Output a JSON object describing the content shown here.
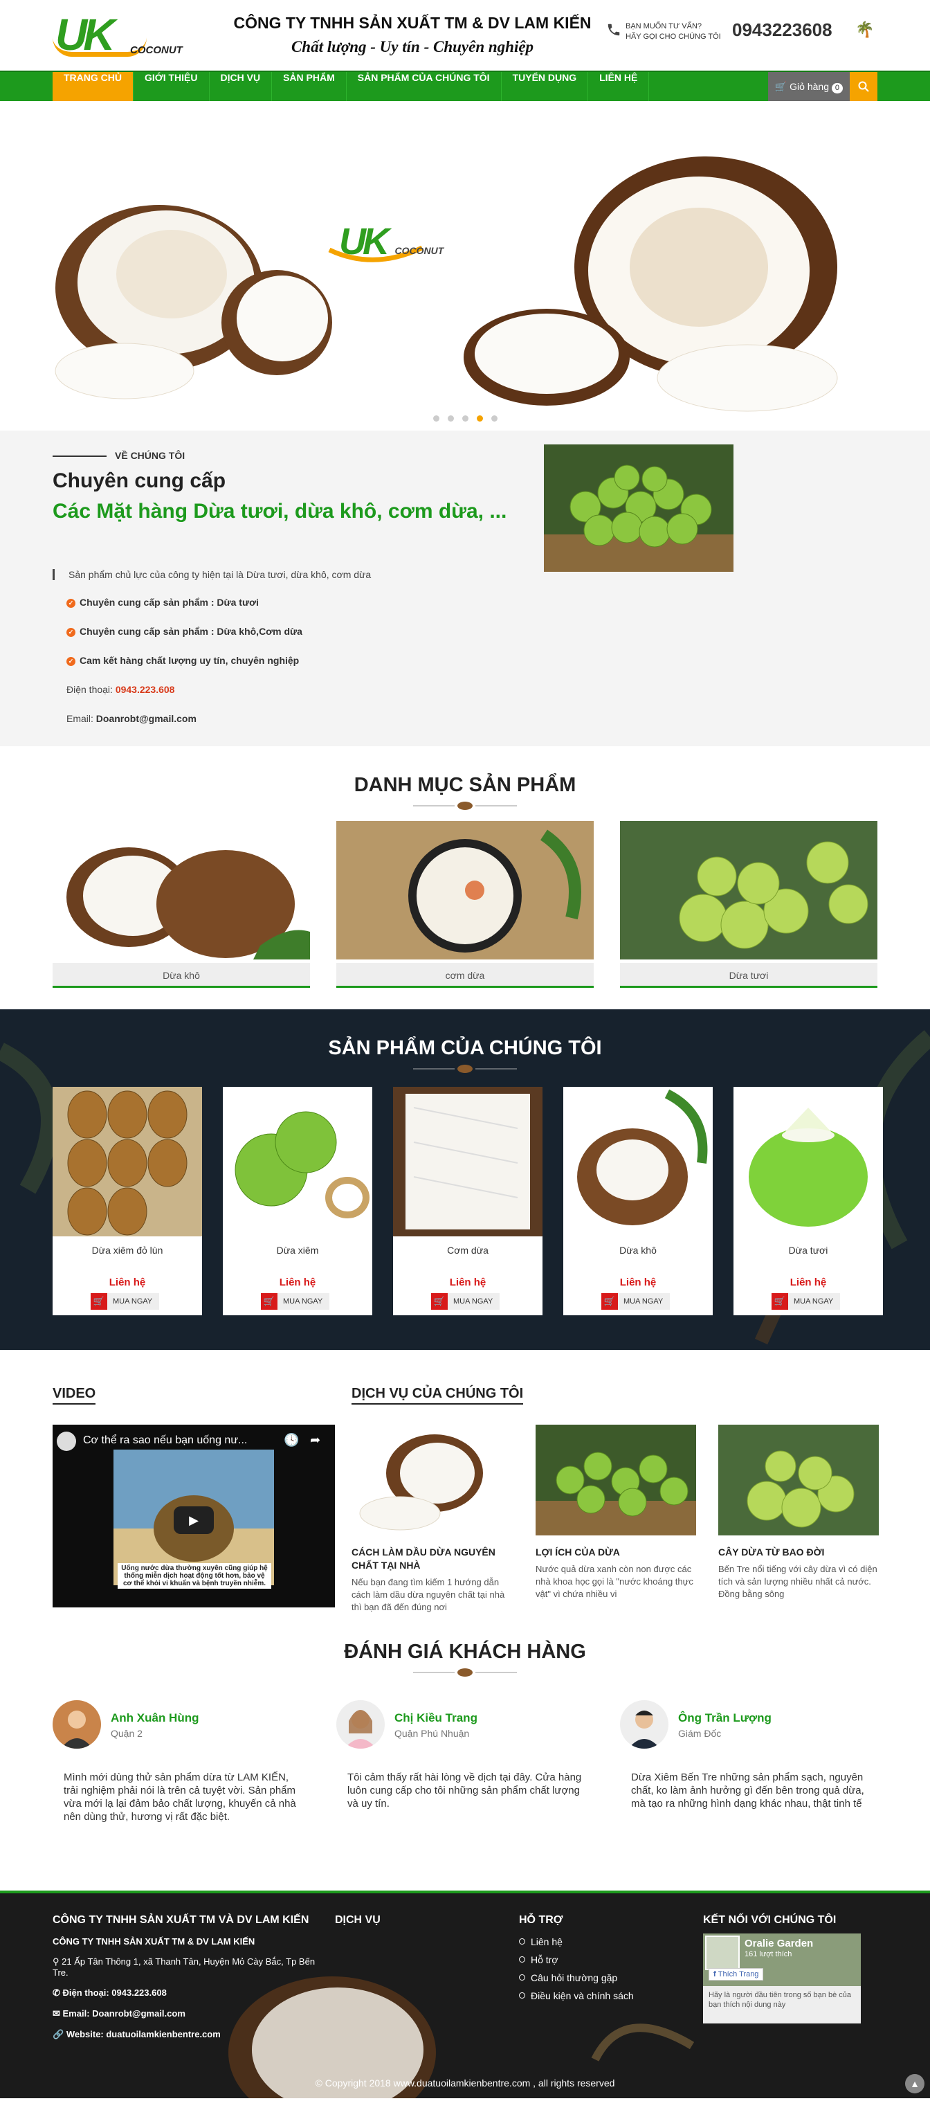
{
  "header": {
    "logo_text": "UK",
    "logo_sub": "COCONUT",
    "company_name": "CÔNG TY TNHH SẢN XUẤT TM & DV LAM KIẾN",
    "slogan": "Chất lượng - Uy tín - Chuyên nghiệp",
    "hotline_q1": "BẠN MUỐN TƯ VẤN?",
    "hotline_q2": "HÃY GỌI CHO CHÚNG TÔI",
    "hotline_number": "0943223608"
  },
  "nav": {
    "items": [
      "Trang chủ",
      "Giới thiệu",
      "Dịch vụ",
      "Sản phẩm",
      "Sản phẩm của chúng tôi",
      "Tuyển dụng",
      "Liên hệ"
    ],
    "cart_label": "Giỏ hàng",
    "cart_count": "0"
  },
  "slider": {
    "logo_text": "UK",
    "logo_sub": "COCONUT",
    "active_slide": 4,
    "total_slides": 5
  },
  "about": {
    "tag": "VỀ CHÚNG TÔI",
    "heading": "Chuyên cung cấp",
    "subheading": "Các Mặt hàng Dừa tươi, dừa khô, cơm dừa, ...",
    "intro": "Sản phẩm chủ lực của công ty hiện tại là Dừa tươi, dừa khô, cơm dừa",
    "checks": [
      "Chuyên cung cấp sản phẩm : Dừa tươi",
      "Chuyên cung cấp sản phẩm : Dừa khô,Cơm dừa",
      "Cam kết hàng chất lượng uy tín, chuyên nghiệp"
    ],
    "phone_label": "Điện thoại:",
    "phone": "0943.223.608",
    "email_label": "Email:",
    "email": "Doanrobt@gmail.com"
  },
  "categories": {
    "title": "DANH MỤC SẢN PHẨM",
    "items": [
      "Dừa khô",
      "cơm dừa",
      "Dừa tươi"
    ]
  },
  "products": {
    "title": "SẢN PHẨM CỦA CHÚNG TÔI",
    "price_label": "Liên hệ",
    "buy_label": "MUA NGAY",
    "items": [
      "Dừa xiêm đỏ lùn",
      "Dừa xiêm",
      "Cơm dừa",
      "Dừa khô",
      "Dừa tươi"
    ]
  },
  "video": {
    "heading": "VIDEO",
    "title": "Cơ thể ra sao nếu bạn uống nư...",
    "caption": "Uống nước dừa thường xuyên cũng giúp hệ thống miễn dịch hoạt động tốt hơn, bảo vệ cơ thể khỏi vi khuẩn và bệnh truyền nhiễm."
  },
  "services": {
    "heading": "DỊCH VỤ CỦA CHÚNG TÔI",
    "items": [
      {
        "title": "CÁCH LÀM DẦU DỪA NGUYÊN CHẤT TẠI NHÀ",
        "desc": "Nếu bạn đang tìm kiếm 1 hướng dẫn cách làm dầu dừa nguyên chất tại nhà thì bạn đã đến đúng nơi"
      },
      {
        "title": "LỢI ÍCH CỦA DỪA",
        "desc": "Nước quả dừa xanh còn non được các nhà khoa học gọi là \"nước khoáng thực vật\" vì chứa nhiều vi"
      },
      {
        "title": "CÂY DỪA TỪ BAO ĐỜI",
        "desc": "Bến Tre nổi tiếng với cây dừa vì có diện tích và sản lượng nhiều nhất cả nước. Đồng bằng sông"
      }
    ]
  },
  "reviews": {
    "title": "ĐÁNH GIÁ KHÁCH HÀNG",
    "items": [
      {
        "name": "Anh Xuân Hùng",
        "role": "Quận 2",
        "text": "Mình mới dùng thử sản phẩm dừa từ LAM KIẾN, trải nghiệm phải nói là trên cả tuyệt vời. Sản phẩm vừa mới lạ lại đảm bảo chất lượng, khuyến cả nhà nên dùng thử, hương vị rất đặc biệt."
      },
      {
        "name": "Chị Kiều Trang",
        "role": "Quận Phú Nhuận",
        "text": "Tôi cảm thấy rất hài lòng về dịch tại đây. Cửa hàng luôn cung cấp cho tôi những sản phẩm chất lượng và uy tín."
      },
      {
        "name": "Ông Trần Lượng",
        "role": "Giám Đốc",
        "text": "Dừa Xiêm Bến Tre những sản phẩm sạch, nguyên chất, ko làm ảnh hưởng gì đến bên trong quả dừa, mà tạo ra những hình dạng khác nhau, thật tinh tế"
      }
    ]
  },
  "footer": {
    "col1_title": "CÔNG TY TNHH SẢN XUẤT TM VÀ DV LAM KIẾN",
    "col1_sub": "CÔNG TY TNHH SẢN XUẤT TM & DV LAM KIẾN",
    "address": "21 Ấp Tân Thông 1, xã Thanh Tân, Huyện Mỏ Cày Bắc, Tp Bến Tre.",
    "phone": "Điện thoại: 0943.223.608",
    "email": "Email: Doanrobt@gmail.com",
    "website": "Website: duatuoilamkienbentre.com",
    "col2_title": "DỊCH VỤ",
    "col3_title": "HỖ TRỢ",
    "support": [
      "Liên hệ",
      "Hỗ trợ",
      "Câu hỏi thường gặp",
      "Điều kiện và chính sách"
    ],
    "col4_title": "KẾT NỐI VỚI CHÚNG TÔI",
    "fb_name": "Oralie Garden",
    "fb_likes": "161 lượt thích",
    "fb_like_btn": "Thích Trang",
    "fb_note": "Hãy là người đầu tiên trong số bạn bè của bạn thích nội dung này",
    "copyright": "© Copyright 2018 www.duatuoilamkienbentre.com , all rights reserved"
  },
  "colors": {
    "brand_green": "#1d9a1d",
    "accent_orange": "#f5a300",
    "price_red": "#d81a1a"
  }
}
